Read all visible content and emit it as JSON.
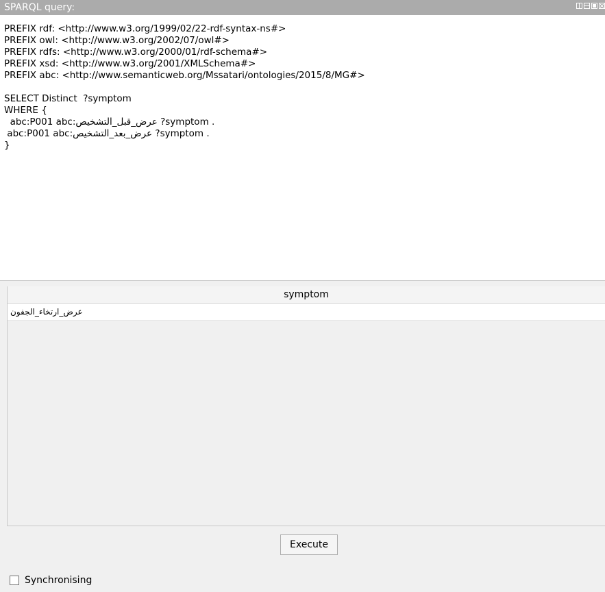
{
  "window": {
    "title": "SPARQL query:"
  },
  "editor": {
    "lines": [
      "PREFIX rdf: <http://www.w3.org/1999/02/22-rdf-syntax-ns#>",
      "PREFIX owl: <http://www.w3.org/2002/07/owl#>",
      "PREFIX rdfs: <http://www.w3.org/2000/01/rdf-schema#>",
      "PREFIX xsd: <http://www.w3.org/2001/XMLSchema#>",
      "PREFIX abc: <http://www.semanticweb.org/Mssatari/ontologies/2015/8/MG#>",
      "",
      "SELECT Distinct  ?symptom",
      "WHERE {",
      "  abc:P001 abc:عرض_قبل_التشخيص ?symptom .",
      " abc:P001 abc:عرض_بعد_التشخيص ?symptom .",
      "}"
    ]
  },
  "results": {
    "columns": [
      "symptom"
    ],
    "rows": [
      [
        "عرض_ارتخاء_الجفون"
      ]
    ]
  },
  "buttons": {
    "execute": "Execute"
  },
  "sync": {
    "label": "Synchronising",
    "checked": false
  },
  "icons": {
    "title_controls": [
      "split-vertical-icon",
      "split-horizontal-icon",
      "maximize-icon",
      "close-icon"
    ]
  }
}
